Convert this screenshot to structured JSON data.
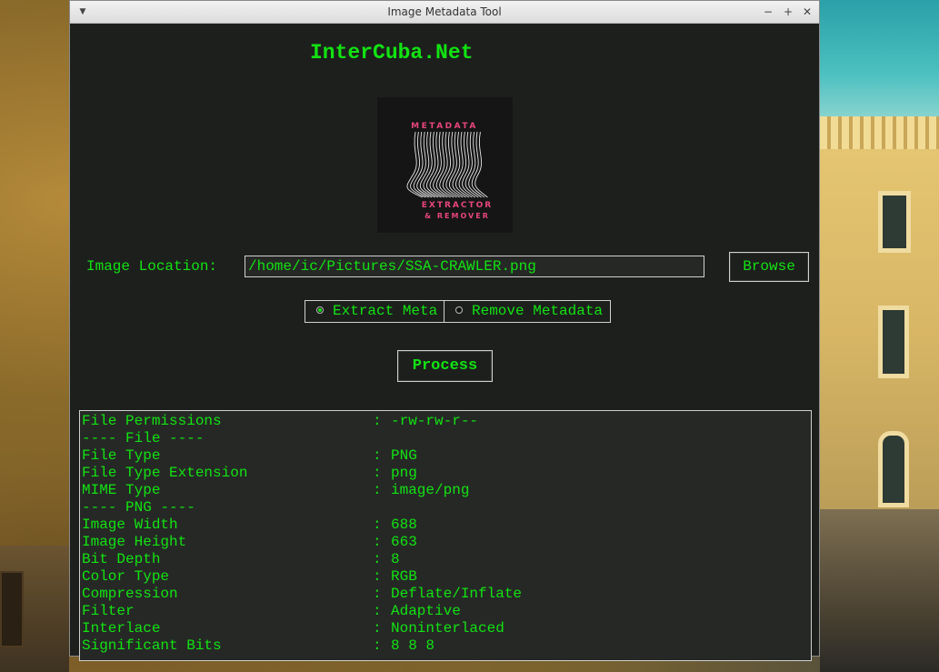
{
  "window": {
    "title": "Image Metadata Tool",
    "menu_icon": "▼",
    "minimize_icon": "−",
    "maximize_icon": "+",
    "close_icon": "✕"
  },
  "app": {
    "heading": "InterCuba.Net",
    "logo": {
      "top_text": "METADATA",
      "bottom_text_1": "EXTRACTOR",
      "bottom_text_2": "& REMOVER"
    },
    "location_label": "Image Location:",
    "location_value": "/home/ic/Pictures/SSA-CRAWLER.png",
    "browse_label": "Browse",
    "mode_options": [
      {
        "label": "Extract Meta",
        "selected": true
      },
      {
        "label": "Remove Metadata",
        "selected": false
      }
    ],
    "process_label": "Process"
  },
  "output": {
    "rows": [
      {
        "key": "File Permissions",
        "sep": ":",
        "value": "-rw-rw-r--"
      },
      {
        "key": "---- File ----",
        "sep": "",
        "value": ""
      },
      {
        "key": "File Type",
        "sep": ":",
        "value": "PNG"
      },
      {
        "key": "File Type Extension",
        "sep": ":",
        "value": "png"
      },
      {
        "key": "MIME Type",
        "sep": ":",
        "value": "image/png"
      },
      {
        "key": "---- PNG ----",
        "sep": "",
        "value": ""
      },
      {
        "key": "Image Width",
        "sep": ":",
        "value": "688"
      },
      {
        "key": "Image Height",
        "sep": ":",
        "value": "663"
      },
      {
        "key": "Bit Depth",
        "sep": ":",
        "value": "8"
      },
      {
        "key": "Color Type",
        "sep": ":",
        "value": "RGB"
      },
      {
        "key": "Compression",
        "sep": ":",
        "value": "Deflate/Inflate"
      },
      {
        "key": "Filter",
        "sep": ":",
        "value": "Adaptive"
      },
      {
        "key": "Interlace",
        "sep": ":",
        "value": "Noninterlaced"
      },
      {
        "key": "Significant Bits",
        "sep": ":",
        "value": "8 8 8"
      }
    ]
  },
  "colors": {
    "text_green": "#12e312",
    "window_bg": "#1d1f1d",
    "logo_pink": "#e8467c"
  }
}
